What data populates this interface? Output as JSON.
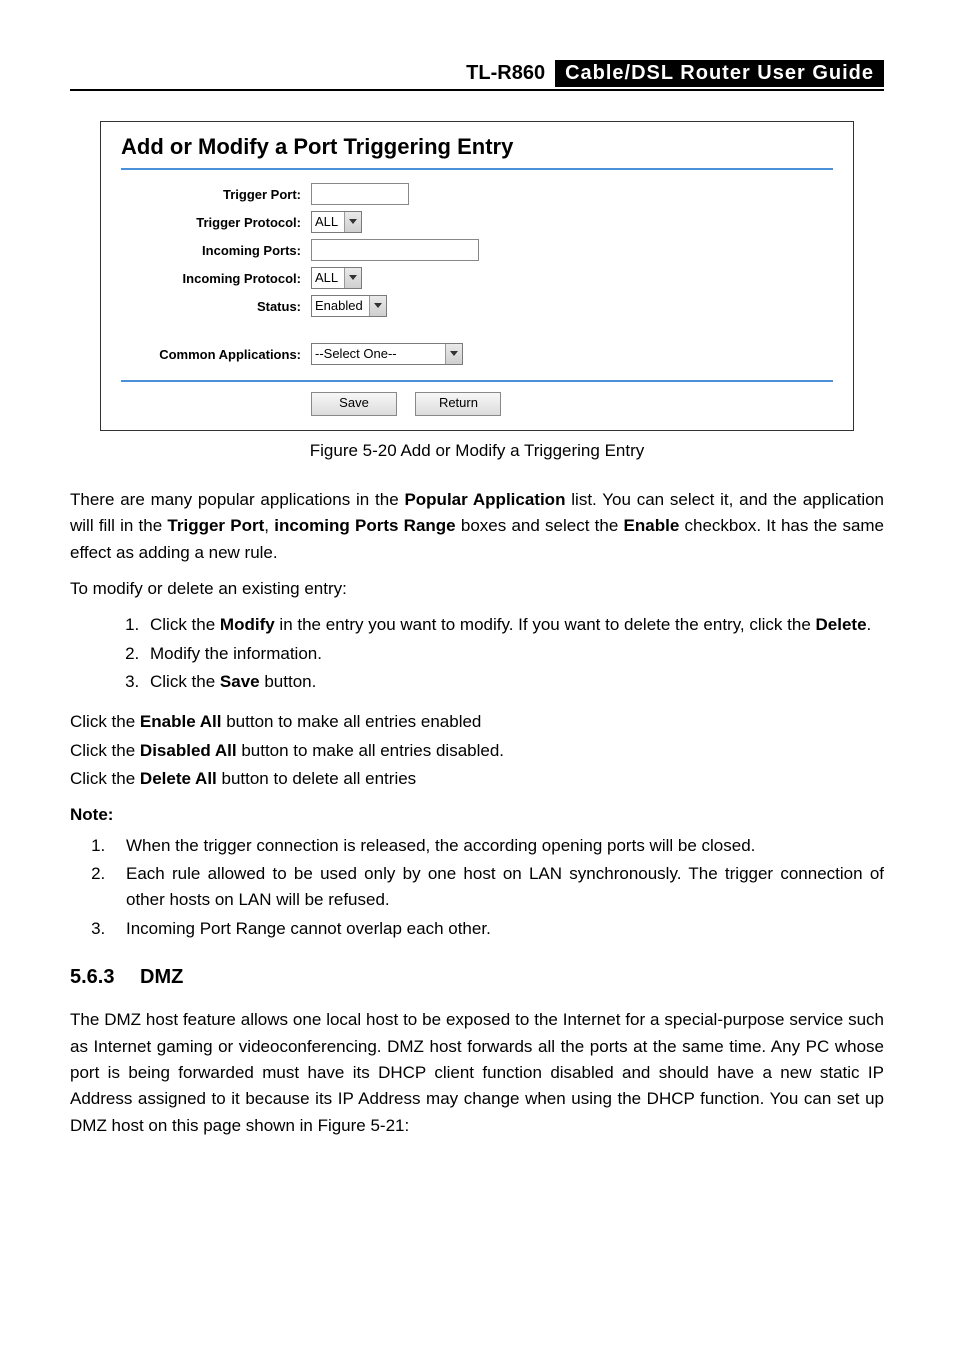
{
  "header": {
    "model": "TL-R860",
    "title": "Cable/DSL  Router  User  Guide"
  },
  "router_form": {
    "title": "Add or Modify a Port Triggering Entry",
    "labels": {
      "trigger_port": "Trigger Port:",
      "trigger_protocol": "Trigger Protocol:",
      "incoming_ports": "Incoming Ports:",
      "incoming_protocol": "Incoming Protocol:",
      "status": "Status:",
      "common_apps": "Common Applications:"
    },
    "values": {
      "trigger_port": "",
      "trigger_protocol": "ALL",
      "incoming_ports": "",
      "incoming_protocol": "ALL",
      "status": "Enabled",
      "common_apps": "--Select One--"
    },
    "buttons": {
      "save": "Save",
      "return": "Return"
    }
  },
  "figure_caption": "Figure 5-20 Add or Modify a Triggering Entry",
  "paragraphs": {
    "popular_pre": "There are many popular applications in the ",
    "popular_bold": "Popular Application",
    "popular_mid1": " list. You can select it, and the application will fill in the ",
    "trigger_port_bold": "Trigger Port",
    "comma_sep": ", ",
    "incoming_ports_bold": "incoming Ports Range",
    "popular_mid2": " boxes and select the ",
    "enable_bold": "Enable",
    "popular_end": " checkbox. It has the same effect as adding a new rule.",
    "modify_intro": "To modify or delete an existing entry:",
    "step1_pre": "Click the ",
    "step1_modify": "Modify",
    "step1_mid": " in the entry you want to modify. If you want to delete the entry, click the ",
    "step1_delete": "Delete",
    "step1_end": ".",
    "step2": "Modify the information.",
    "step3_pre": "Click the ",
    "step3_save": "Save",
    "step3_end": " button.",
    "enable_all_pre": "Click the ",
    "enable_all_bold": "Enable All",
    "enable_all_end": " button to make all entries enabled",
    "disable_all_pre": "Click the ",
    "disable_all_bold": "Disabled All",
    "disable_all_end": " button to make all entries disabled.",
    "delete_all_pre": "Click the ",
    "delete_all_bold": "Delete All",
    "delete_all_end": " button to delete all entries",
    "note_label": "Note:",
    "note1": "When the trigger connection is released, the according opening ports will be closed.",
    "note2": "Each rule allowed to be used only by one host on LAN synchronously. The trigger connection of other hosts on LAN will be refused.",
    "note3": "Incoming Port Range cannot overlap each other.",
    "dmz_para": "The DMZ host feature allows one local host to be exposed to the Internet for a special-purpose service such as Internet gaming or videoconferencing. DMZ host forwards all the ports at the same time. Any PC whose port is being forwarded must have its DHCP client function disabled and should have a new static IP Address assigned to it because its IP Address may change when using the DHCP function. You can set up DMZ host on this page shown in Figure 5-21:"
  },
  "section": {
    "number": "5.6.3",
    "title": "DMZ"
  }
}
